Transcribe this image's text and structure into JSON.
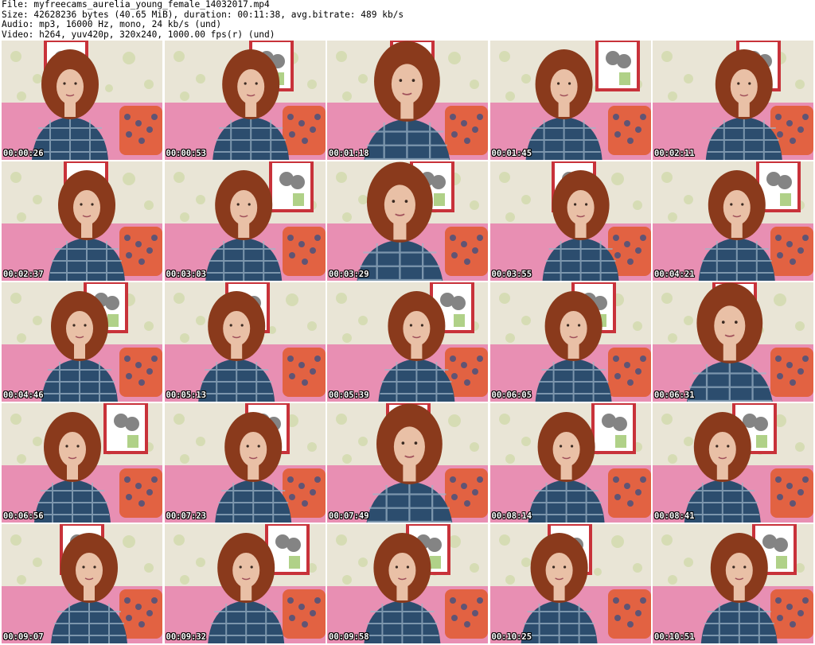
{
  "header": {
    "file_line": "File: myfreecams_aurelia_young_female_14032017.mp4",
    "size_line": "Size: 42628236 bytes (40.65 MiB), duration: 00:11:38, avg.bitrate: 489 kb/s",
    "audio_line": "Audio: mp3, 16000 Hz, mono, 24 kb/s (und)",
    "video_line": "Video: h264, yuv420p, 320x240, 1000.00 fps(r) (und)"
  },
  "colors": {
    "wall": "#e9e5d6",
    "wall_pattern": "#c7d69a",
    "couch": "#e88fb3",
    "hair": "#8a3a1c",
    "skin": "#e9c0a6",
    "shirt_dark": "#2c4d6e",
    "shirt_light": "#9fb6c8",
    "frame": "#c8323a"
  },
  "thumbnails": [
    {
      "time": "00:00:26"
    },
    {
      "time": "00:00:53"
    },
    {
      "time": "00:01:18"
    },
    {
      "time": "00:01:45"
    },
    {
      "time": "00:02:11"
    },
    {
      "time": "00:02:37"
    },
    {
      "time": "00:03:03"
    },
    {
      "time": "00:03:29"
    },
    {
      "time": "00:03:55"
    },
    {
      "time": "00:04:21"
    },
    {
      "time": "00:04:46"
    },
    {
      "time": "00:05:13"
    },
    {
      "time": "00:05:39"
    },
    {
      "time": "00:06:05"
    },
    {
      "time": "00:06:31"
    },
    {
      "time": "00:06:56"
    },
    {
      "time": "00:07:23"
    },
    {
      "time": "00:07:49"
    },
    {
      "time": "00:08:14"
    },
    {
      "time": "00:08:41"
    },
    {
      "time": "00:09:07"
    },
    {
      "time": "00:09:32"
    },
    {
      "time": "00:09:58"
    },
    {
      "time": "00:10:25"
    },
    {
      "time": "00:10:51"
    }
  ]
}
